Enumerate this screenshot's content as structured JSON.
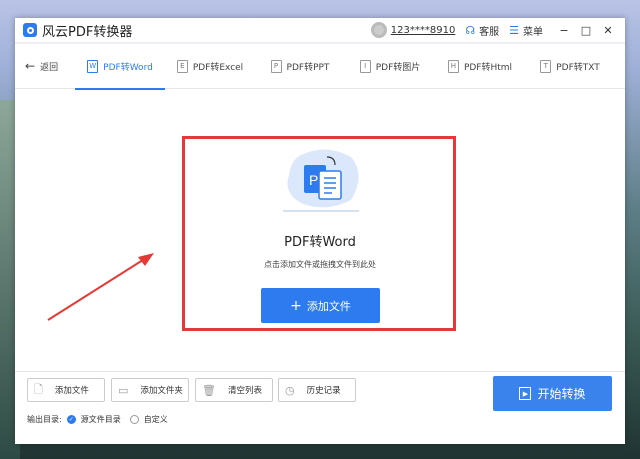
{
  "app": {
    "title": "风云PDF转换器",
    "user": "123****8910",
    "service": "客服",
    "menu": "菜单"
  },
  "nav": {
    "back": "返回",
    "tabs": [
      {
        "label": "PDF转Word",
        "icon": "W"
      },
      {
        "label": "PDF转Excel",
        "icon": "E"
      },
      {
        "label": "PDF转PPT",
        "icon": "P"
      },
      {
        "label": "PDF转图片",
        "icon": "I"
      },
      {
        "label": "PDF转Html",
        "icon": "H"
      },
      {
        "label": "PDF转TXT",
        "icon": "T"
      }
    ]
  },
  "main": {
    "title": "PDF转Word",
    "hint": "点击添加文件或拖拽文件到此处",
    "add_button": "添加文件",
    "illus_letter": "P"
  },
  "toolbar": {
    "add_file": "添加文件",
    "add_folder": "添加文件夹",
    "clear": "清空列表",
    "history": "历史记录"
  },
  "output": {
    "label": "输出目录:",
    "options": [
      "源文件目录",
      "自定义"
    ],
    "selected": "源文件目录"
  },
  "start_button": "开始转换",
  "colors": {
    "accent": "#2e7bf0",
    "highlight": "#e53935"
  }
}
